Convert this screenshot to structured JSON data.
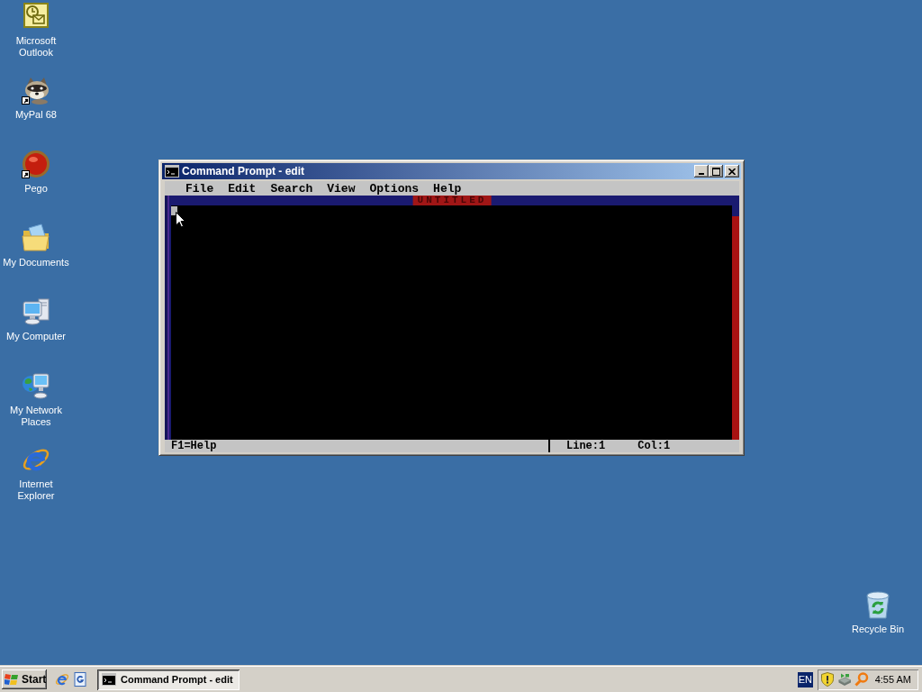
{
  "desktop": {
    "icons": [
      {
        "kind": "outlook",
        "label": "Microsoft Outlook",
        "shortcut": false
      },
      {
        "kind": "raccoon",
        "label": "MyPal 68",
        "shortcut": true
      },
      {
        "kind": "red-ball",
        "label": "Pego",
        "shortcut": true
      },
      {
        "kind": "documents",
        "label": "My Documents",
        "shortcut": false
      },
      {
        "kind": "computer",
        "label": "My Computer",
        "shortcut": false
      },
      {
        "kind": "network",
        "label": "My Network Places",
        "shortcut": false
      },
      {
        "kind": "browser",
        "label": "Internet Explorer",
        "shortcut": false
      }
    ],
    "recycle_bin": {
      "label": "Recycle Bin"
    }
  },
  "window": {
    "title": "Command Prompt - edit",
    "menu": [
      "File",
      "Edit",
      "Search",
      "View",
      "Options",
      "Help"
    ],
    "document_title": "UNTITLED",
    "status": {
      "help": "F1=Help",
      "line": "Line:1",
      "column": "Col:1"
    }
  },
  "taskbar": {
    "start": "Start",
    "quick_launch": [
      {
        "kind": "browser"
      },
      {
        "kind": "page"
      }
    ],
    "tasks": [
      {
        "label": "Command Prompt - edit",
        "selected": true
      }
    ],
    "language": "EN",
    "tray": [
      {
        "kind": "shield"
      },
      {
        "kind": "device"
      },
      {
        "kind": "magnifier"
      }
    ],
    "clock": "4:55 AM"
  }
}
